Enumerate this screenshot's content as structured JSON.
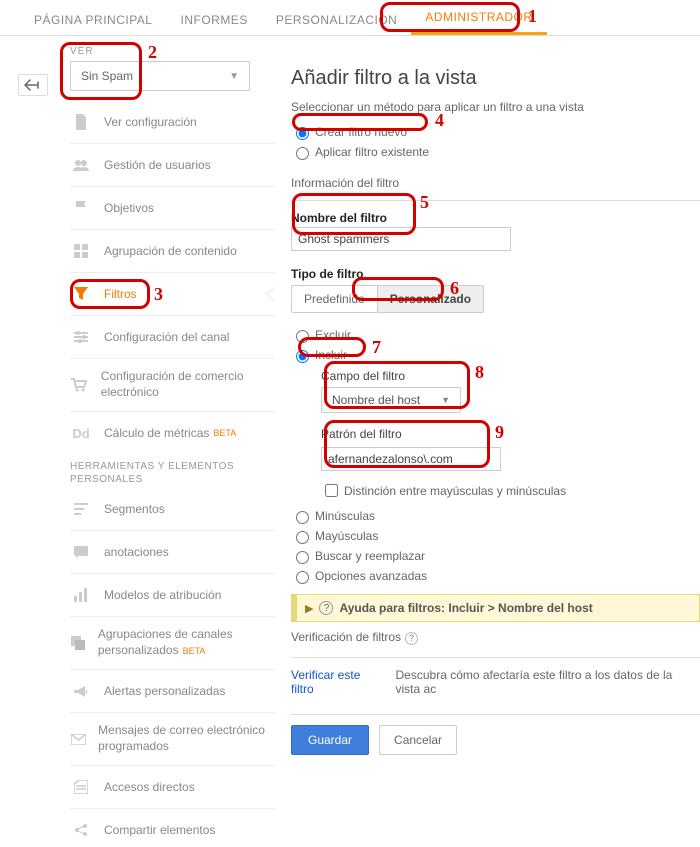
{
  "topnav": {
    "tabs": [
      {
        "label": "PÁGINA PRINCIPAL"
      },
      {
        "label": "INFORMES"
      },
      {
        "label": "PERSONALIZACIÓN"
      },
      {
        "label": "ADMINISTRADOR"
      }
    ]
  },
  "view": {
    "label": "VER",
    "selected": "Sin Spam"
  },
  "sidebar": {
    "items": [
      {
        "label": "Ver configuración"
      },
      {
        "label": "Gestión de usuarios"
      },
      {
        "label": "Objetivos"
      },
      {
        "label": "Agrupación de contenido"
      },
      {
        "label": "Filtros"
      },
      {
        "label": "Configuración del canal"
      },
      {
        "label": "Configuración de comercio electrónico"
      },
      {
        "label": "Cálculo de métricas",
        "beta": "BETA"
      }
    ],
    "tools_heading": "HERRAMIENTAS Y ELEMENTOS PERSONALES",
    "tools": [
      {
        "label": "Segmentos"
      },
      {
        "label": "anotaciones"
      },
      {
        "label": "Modelos de atribución"
      },
      {
        "label": "Agrupaciones de canales personalizados",
        "beta": "BETA"
      },
      {
        "label": "Alertas personalizadas"
      },
      {
        "label": "Mensajes de correo electrónico programados"
      },
      {
        "label": "Accesos directos"
      },
      {
        "label": "Compartir elementos"
      }
    ]
  },
  "main": {
    "title": "Añadir filtro a la vista",
    "select_method": "Seleccionar un método para aplicar un filtro a una vista",
    "radio_new": "Crear filtro nuevo",
    "radio_existing": "Aplicar filtro existente",
    "info_heading": "Información del filtro",
    "name_label": "Nombre del filtro",
    "name_value": "Ghost spammers",
    "type_label": "Tipo de filtro",
    "type_predefined": "Predefinido",
    "type_custom": "Personalizado",
    "radio_excluir": "Excluir",
    "radio_incluir": "Incluir",
    "campo_label": "Campo del filtro",
    "campo_value": "Nombre del host",
    "patron_label": "Patrón del filtro",
    "patron_value": "afernandezalonso\\.com",
    "case_label": "Distinción entre mayúsculas y minúsculas",
    "opt_min": "Minúsculas",
    "opt_may": "Mayúsculas",
    "opt_buscar": "Buscar y reemplazar",
    "opt_adv": "Opciones avanzadas",
    "help_text": "Ayuda para filtros: Incluir  >  Nombre del host",
    "verify_heading": "Verificación de filtros",
    "verify_link": "Verificar este filtro",
    "verify_desc": "Descubra cómo afectaría este filtro a los datos de la vista ac",
    "save": "Guardar",
    "cancel": "Cancelar"
  },
  "annotations": {
    "a1": "1",
    "a2": "2",
    "a3": "3",
    "a4": "4",
    "a5": "5",
    "a6": "6",
    "a7": "7",
    "a8": "8",
    "a9": "9"
  }
}
